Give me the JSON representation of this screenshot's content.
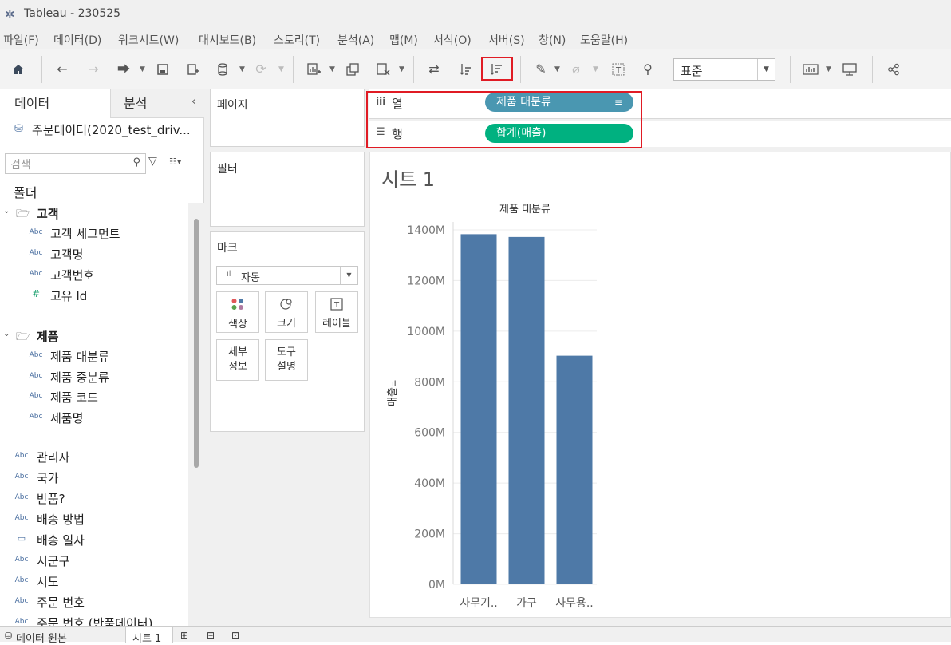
{
  "window": {
    "title": "Tableau - 230525"
  },
  "menu": [
    "파일(F)",
    "데이터(D)",
    "워크시트(W)",
    "대시보드(B)",
    "스토리(T)",
    "분석(A)",
    "맵(M)",
    "서식(O)",
    "서버(S)",
    "창(N)",
    "도움말(H)"
  ],
  "toolbar": {
    "fit_value": "표준"
  },
  "left_pane": {
    "tabs": [
      "데이터",
      "분석"
    ],
    "datasource": "주문데이터(2020_test_driv...",
    "search_placeholder": "검색",
    "folder_label": "폴더",
    "groups": [
      {
        "name": "고객",
        "fields": [
          {
            "type": "Abc",
            "name": "고객 세그먼트"
          },
          {
            "type": "Abc",
            "name": "고객명"
          },
          {
            "type": "Abc",
            "name": "고객번호"
          },
          {
            "type": "#",
            "name": "고유 Id"
          }
        ]
      },
      {
        "name": "제품",
        "fields": [
          {
            "type": "Abc",
            "name": "제품 대분류"
          },
          {
            "type": "Abc",
            "name": "제품 중분류"
          },
          {
            "type": "Abc",
            "name": "제품 코드"
          },
          {
            "type": "Abc",
            "name": "제품명"
          }
        ]
      }
    ],
    "fields": [
      {
        "type": "Abc",
        "name": "관리자"
      },
      {
        "type": "Abc",
        "name": "국가"
      },
      {
        "type": "Abc",
        "name": "반품?"
      },
      {
        "type": "Abc",
        "name": "배송 방법"
      },
      {
        "type": "date",
        "name": "배송 일자"
      },
      {
        "type": "Abc",
        "name": "시군구"
      },
      {
        "type": "Abc",
        "name": "시도"
      },
      {
        "type": "Abc",
        "name": "주문 번호"
      },
      {
        "type": "Abc",
        "name": "주문 번호 (반품데이터)"
      }
    ]
  },
  "shelves": {
    "pages_label": "페이지",
    "filters_label": "필터",
    "columns_label": "열",
    "rows_label": "행",
    "columns_pill": "제품 대분류",
    "rows_pill": "합계(매출)",
    "columns_color": "#4a97b1",
    "rows_color": "#00b180"
  },
  "marks": {
    "label": "마크",
    "type": "자동",
    "buttons": [
      "색상",
      "크기",
      "레이블",
      "세부\n정보",
      "도구\n설명"
    ]
  },
  "sheet": {
    "title": "시트 1"
  },
  "chart_data": {
    "type": "bar",
    "title": "제품 대분류",
    "categories": [
      "사무기..",
      "가구",
      "사무용.."
    ],
    "values": [
      1383000000,
      1372000000,
      903000000
    ],
    "ylabel": "매출",
    "yticks": [
      "0M",
      "200M",
      "400M",
      "600M",
      "800M",
      "1000M",
      "1200M",
      "1400M"
    ],
    "ylim": [
      0,
      1400000000
    ],
    "bar_color": "#4e79a7",
    "grid": true
  },
  "status_bar": {
    "datasource_tab": "데이터 원본",
    "sheet_tab": "시트 1"
  }
}
